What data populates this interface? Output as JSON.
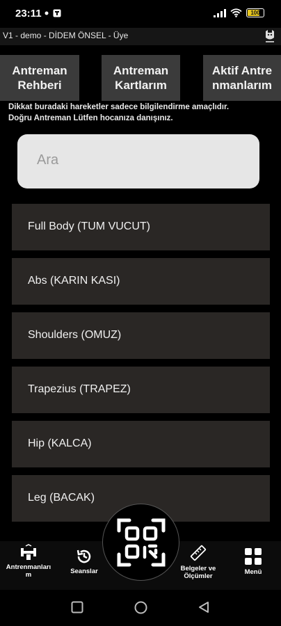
{
  "status": {
    "time": "23:11",
    "battery": "100"
  },
  "header": {
    "title": "V1 - demo - DİDEM ÖNSEL - Üye"
  },
  "tabs": [
    {
      "label_line1": "Antreman",
      "label_line2": "Rehberi"
    },
    {
      "label_line1": "Antreman",
      "label_line2": "Kartlarım"
    },
    {
      "label_line1": "Aktif Antre",
      "label_line2": "nmanlarım"
    }
  ],
  "notice": {
    "line1": "Dikkat buradaki hareketler sadece bilgilendirme amaçlıdır.",
    "line2": "Doğru Antreman Lütfen hocanıza danışınız."
  },
  "search": {
    "placeholder": "Ara"
  },
  "categories": [
    {
      "label": "Full Body (TUM VUCUT)"
    },
    {
      "label": "Abs (KARIN KASI)"
    },
    {
      "label": "Shoulders (OMUZ)"
    },
    {
      "label": "Trapezius (TRAPEZ)"
    },
    {
      "label": "Hip (KALCA)"
    },
    {
      "label": "Leg (BACAK)"
    }
  ],
  "bottom_nav": {
    "workouts_line1": "Antrenmanları",
    "workouts_line2": "m",
    "sessions": "Seanslar",
    "docs_line1": "Belgeler ve",
    "docs_line2": "Ölçümler",
    "menu": "Menü"
  },
  "colors": {
    "background": "#000000",
    "tab_bg": "#3b3b3b",
    "list_item_bg": "#2a2725",
    "search_bg": "#e6e6e6",
    "battery_accent": "#e8c820"
  },
  "icons": {
    "workouts": "dumbbell-icon",
    "sessions": "history-icon",
    "qr": "qr-scan-icon",
    "docs": "ruler-icon",
    "menu": "grid-menu-icon"
  }
}
